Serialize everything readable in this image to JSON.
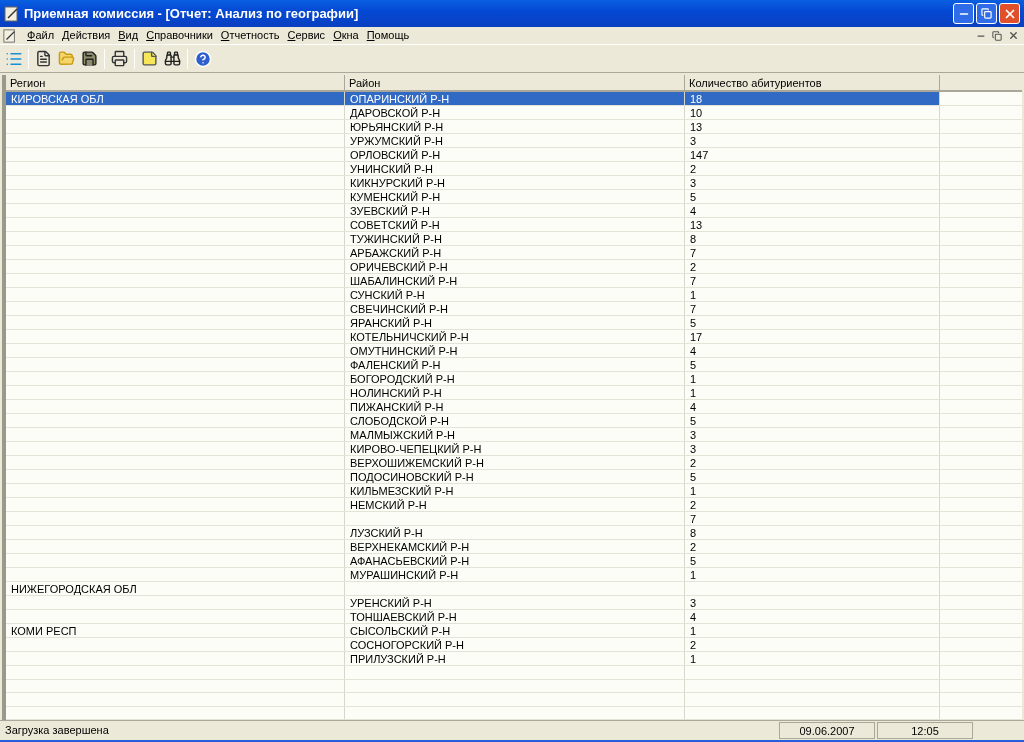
{
  "window": {
    "title": "Приемная комиссия - [Отчет: Анализ по географии]"
  },
  "menu": [
    "Файл",
    "Действия",
    "Вид",
    "Справочники",
    "Отчетность",
    "Сервис",
    "Окна",
    "Помощь"
  ],
  "table": {
    "columns": [
      "Регион",
      "Район",
      "Количество абитуриентов"
    ],
    "rows": [
      {
        "region": "КИРОВСКАЯ ОБЛ",
        "district": "ОПАРИНСКИЙ Р-Н",
        "count": "18",
        "selected": true
      },
      {
        "district": "ДАРОВСКОЙ Р-Н",
        "count": "10",
        "selected": false
      },
      {
        "district": "ЮРЬЯНСКИЙ Р-Н",
        "count": "13",
        "selected": false
      },
      {
        "district": "УРЖУМСКИЙ Р-Н",
        "count": "3",
        "selected": false
      },
      {
        "district": "ОРЛОВСКИЙ Р-Н",
        "count": "147",
        "selected": false
      },
      {
        "district": "УНИНСКИЙ Р-Н",
        "count": "2",
        "selected": false
      },
      {
        "district": "КИКНУРСКИЙ Р-Н",
        "count": "3",
        "selected": false
      },
      {
        "district": "КУМЕНСКИЙ Р-Н",
        "count": "5",
        "selected": false
      },
      {
        "district": "ЗУЕВСКИЙ Р-Н",
        "count": "4",
        "selected": false
      },
      {
        "district": "СОВЕТСКИЙ Р-Н",
        "count": "13",
        "selected": false
      },
      {
        "district": "ТУЖИНСКИЙ Р-Н",
        "count": "8",
        "selected": false
      },
      {
        "district": "АРБАЖСКИЙ Р-Н",
        "count": "7",
        "selected": false
      },
      {
        "district": "ОРИЧЕВСКИЙ Р-Н",
        "count": "2",
        "selected": false
      },
      {
        "district": "ШАБАЛИНСКИЙ Р-Н",
        "count": "7",
        "selected": false
      },
      {
        "district": "СУНСКИЙ Р-Н",
        "count": "1",
        "selected": false
      },
      {
        "district": "СВЕЧИНСКИЙ Р-Н",
        "count": "7",
        "selected": false
      },
      {
        "district": "ЯРАНСКИЙ Р-Н",
        "count": "5",
        "selected": false
      },
      {
        "district": "КОТЕЛЬНИЧСКИЙ Р-Н",
        "count": "17",
        "selected": false
      },
      {
        "district": "ОМУТНИНСКИЙ Р-Н",
        "count": "4",
        "selected": false
      },
      {
        "district": "ФАЛЕНСКИЙ Р-Н",
        "count": "5",
        "selected": false
      },
      {
        "district": "БОГОРОДСКИЙ Р-Н",
        "count": "1",
        "selected": false
      },
      {
        "district": "НОЛИНСКИЙ Р-Н",
        "count": "1",
        "selected": false
      },
      {
        "district": "ПИЖАНСКИЙ Р-Н",
        "count": "4",
        "selected": false
      },
      {
        "district": "СЛОБОДСКОЙ Р-Н",
        "count": "5",
        "selected": false
      },
      {
        "district": "МАЛМЫЖСКИЙ Р-Н",
        "count": "3",
        "selected": false
      },
      {
        "district": "КИРОВО-ЧЕПЕЦКИЙ Р-Н",
        "count": "3",
        "selected": false
      },
      {
        "district": "ВЕРХОШИЖЕМСКИЙ Р-Н",
        "count": "2",
        "selected": false
      },
      {
        "district": "ПОДОСИНОВСКИЙ Р-Н",
        "count": "5",
        "selected": false
      },
      {
        "district": "КИЛЬМЕЗСКИЙ Р-Н",
        "count": "1",
        "selected": false
      },
      {
        "district": "НЕМСКИЙ Р-Н",
        "count": "2",
        "selected": false
      },
      {
        "count": "7",
        "selected": false
      },
      {
        "district": "ЛУЗСКИЙ Р-Н",
        "count": "8",
        "selected": false
      },
      {
        "district": "ВЕРХНЕКАМСКИЙ Р-Н",
        "count": "2",
        "selected": false
      },
      {
        "district": "АФАНАСЬЕВСКИЙ Р-Н",
        "count": "5",
        "selected": false
      },
      {
        "district": "МУРАШИНСКИЙ Р-Н",
        "count": "1",
        "selected": false
      },
      {
        "region": "НИЖЕГОРОДСКАЯ ОБЛ",
        "selected": false
      },
      {
        "district": "УРЕНСКИЙ Р-Н",
        "count": "3",
        "selected": false
      },
      {
        "district": "ТОНШАЕВСКИЙ Р-Н",
        "count": "4",
        "selected": false
      },
      {
        "region": "КОМИ РЕСП",
        "district": "СЫСОЛЬСКИЙ Р-Н",
        "count": "1",
        "selected": false
      },
      {
        "district": "СОСНОГОРСКИЙ Р-Н",
        "count": "2",
        "selected": false
      },
      {
        "district": "ПРИЛУЗСКИЙ Р-Н",
        "count": "1",
        "selected": false
      }
    ]
  },
  "status_bar": {
    "message": "Загрузка завершена",
    "date": "09.06.2007",
    "time": "12:05"
  }
}
